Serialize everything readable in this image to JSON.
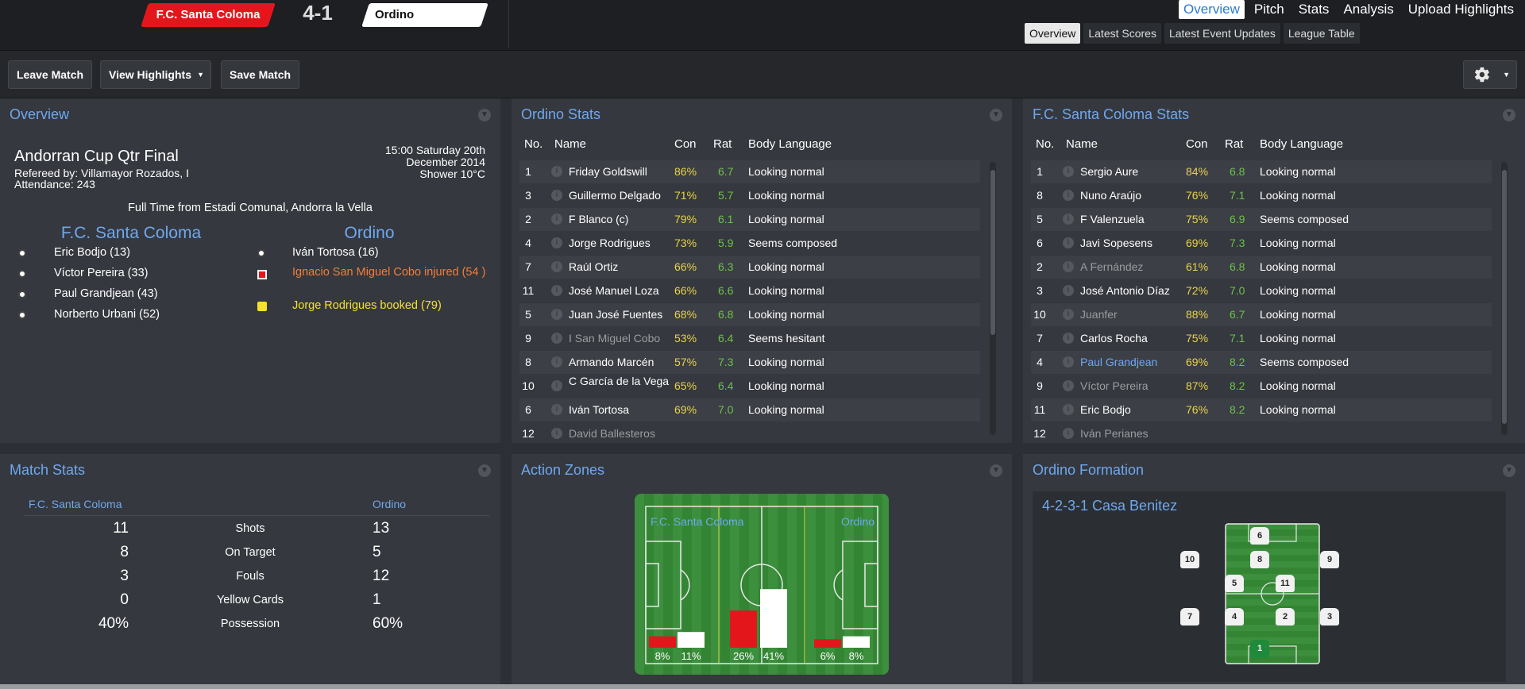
{
  "header": {
    "home_team": "F.C. Santa Coloma",
    "score": "4-1",
    "away_team": "Ordino",
    "nav": [
      "Overview",
      "Pitch",
      "Stats",
      "Analysis",
      "Upload Highlights"
    ],
    "subnav": [
      "Overview",
      "Latest Scores",
      "Latest Event Updates",
      "League Table"
    ]
  },
  "toolbar": {
    "leave": "Leave Match",
    "highlights": "View Highlights",
    "save": "Save Match"
  },
  "overview": {
    "title": "Overview",
    "competition": "Andorran Cup Qtr Final",
    "referee": "Refereed by: Villamayor Rozados, I",
    "attendance": "Attendance: 243",
    "date_line1": "15:00 Saturday 20th",
    "date_line2": "December 2014",
    "weather": "Shower 10°C",
    "fulltime": "Full Time from Estadi Comunal, Andorra la Vella",
    "home_name": "F.C. Santa Coloma",
    "away_name": "Ordino",
    "home_events": [
      "Eric Bodjo (13)",
      "Víctor Pereira (33)",
      "Paul Grandjean (43)",
      "Norberto Urbani (52)"
    ],
    "away_events": [
      {
        "text": "Iván Tortosa (16)",
        "type": "goal"
      },
      {
        "text": "Ignacio San Miguel Cobo injured (54 )",
        "type": "injury"
      },
      {
        "text": "Jorge Rodrigues booked (79)",
        "type": "yellow"
      }
    ]
  },
  "ordino_stats": {
    "title": "Ordino Stats",
    "headers": [
      "No.",
      "Name",
      "Con",
      "Rat",
      "Body Language"
    ],
    "rows": [
      {
        "no": "1",
        "name": "Friday Goldswill",
        "con": "86%",
        "rat": "6.7",
        "body": "Looking normal",
        "dim": false
      },
      {
        "no": "3",
        "name": "Guillermo Delgado",
        "con": "71%",
        "rat": "5.7",
        "body": "Looking normal",
        "dim": false
      },
      {
        "no": "2",
        "name": "F Blanco (c)",
        "con": "79%",
        "rat": "6.1",
        "body": "Looking normal",
        "dim": false
      },
      {
        "no": "4",
        "name": "Jorge Rodrigues",
        "con": "73%",
        "rat": "5.9",
        "body": "Seems composed",
        "dim": false
      },
      {
        "no": "7",
        "name": "Raúl Ortiz",
        "con": "66%",
        "rat": "6.3",
        "body": "Looking normal",
        "dim": false
      },
      {
        "no": "11",
        "name": "José Manuel Loza",
        "con": "66%",
        "rat": "6.6",
        "body": "Looking normal",
        "dim": false
      },
      {
        "no": "5",
        "name": "Juan José Fuentes",
        "con": "68%",
        "rat": "6.8",
        "body": "Looking normal",
        "dim": false
      },
      {
        "no": "9",
        "name": "I San Miguel Cobo",
        "con": "53%",
        "rat": "6.4",
        "body": "Seems hesitant",
        "dim": true
      },
      {
        "no": "8",
        "name": "Armando Marcén",
        "con": "57%",
        "rat": "7.3",
        "body": "Looking normal",
        "dim": false
      },
      {
        "no": "10",
        "name": "C García de la Vega",
        "con": "65%",
        "rat": "6.4",
        "body": "Looking normal",
        "dim": false
      },
      {
        "no": "6",
        "name": "Iván Tortosa",
        "con": "69%",
        "rat": "7.0",
        "body": "Looking normal",
        "dim": false
      },
      {
        "no": "12",
        "name": "David Ballesteros",
        "con": "",
        "rat": "",
        "body": "",
        "dim": true
      }
    ]
  },
  "fcsc_stats": {
    "title": "F.C. Santa Coloma Stats",
    "headers": [
      "No.",
      "Name",
      "Con",
      "Rat",
      "Body Language"
    ],
    "rows": [
      {
        "no": "1",
        "name": "Sergio Aure",
        "con": "84%",
        "rat": "6.8",
        "body": "Looking normal",
        "dim": false
      },
      {
        "no": "8",
        "name": "Nuno Araújo",
        "con": "76%",
        "rat": "7.1",
        "body": "Looking normal",
        "dim": false
      },
      {
        "no": "5",
        "name": "F Valenzuela",
        "con": "75%",
        "rat": "6.9",
        "body": "Seems composed",
        "dim": false
      },
      {
        "no": "6",
        "name": "Javi Sopesens",
        "con": "69%",
        "rat": "7.3",
        "body": "Looking normal",
        "dim": false
      },
      {
        "no": "2",
        "name": "A Fernández",
        "con": "61%",
        "rat": "6.8",
        "body": "Looking normal",
        "dim": true
      },
      {
        "no": "3",
        "name": "José Antonio Díaz",
        "con": "72%",
        "rat": "7.0",
        "body": "Looking normal",
        "dim": false
      },
      {
        "no": "10",
        "name": "Juanfer",
        "con": "88%",
        "rat": "6.7",
        "body": "Looking normal",
        "dim": true
      },
      {
        "no": "7",
        "name": "Carlos Rocha",
        "con": "75%",
        "rat": "7.1",
        "body": "Looking normal",
        "dim": false
      },
      {
        "no": "4",
        "name": "Paul Grandjean",
        "con": "69%",
        "rat": "8.2",
        "body": "Seems composed",
        "dim": false,
        "highlight": true
      },
      {
        "no": "9",
        "name": "Víctor Pereira",
        "con": "87%",
        "rat": "8.2",
        "body": "Looking normal",
        "dim": true
      },
      {
        "no": "11",
        "name": "Eric Bodjo",
        "con": "76%",
        "rat": "8.2",
        "body": "Looking normal",
        "dim": false
      },
      {
        "no": "12",
        "name": "Iván Perianes",
        "con": "",
        "rat": "",
        "body": "",
        "dim": true
      }
    ]
  },
  "match_stats": {
    "title": "Match Stats",
    "home": "F.C. Santa Coloma",
    "away": "Ordino",
    "rows": [
      {
        "home": "11",
        "label": "Shots",
        "away": "13"
      },
      {
        "home": "8",
        "label": "On Target",
        "away": "5"
      },
      {
        "home": "3",
        "label": "Fouls",
        "away": "12"
      },
      {
        "home": "0",
        "label": "Yellow Cards",
        "away": "1"
      },
      {
        "home": "40%",
        "label": "Possession",
        "away": "60%"
      }
    ]
  },
  "action_zones": {
    "title": "Action Zones",
    "home": "F.C. Santa Coloma",
    "away": "Ordino",
    "zones": [
      {
        "home": 8,
        "away": 11,
        "home_label": "8%",
        "away_label": "11%"
      },
      {
        "home": 26,
        "away": 41,
        "home_label": "26%",
        "away_label": "41%"
      },
      {
        "home": 6,
        "away": 8,
        "home_label": "6%",
        "away_label": "8%"
      }
    ]
  },
  "formation": {
    "title": "Ordino Formation",
    "name": "4-2-3-1 Casa Benitez",
    "players": [
      "6",
      "10",
      "8",
      "9",
      "5",
      "11",
      "7",
      "4",
      "2",
      "3",
      "1"
    ]
  },
  "colors": {
    "accent": "#6fa8ef",
    "home_red": "#e3171b",
    "con_yellow": "#e8d34a",
    "rat_green": "#6cc24a"
  }
}
